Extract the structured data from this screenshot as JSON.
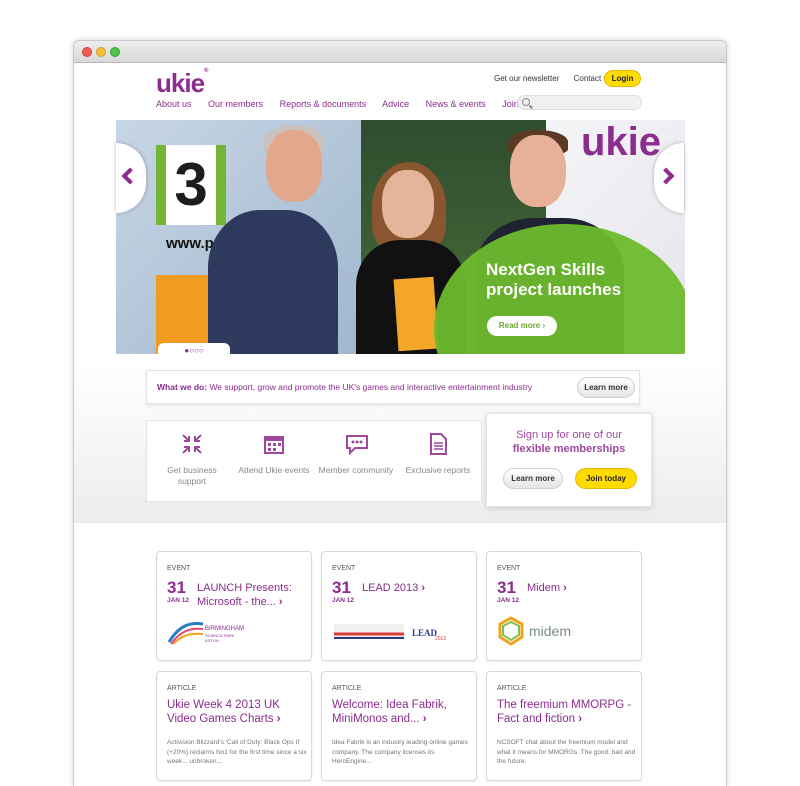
{
  "header": {
    "logo_text": "ukie",
    "newsletter_link": "Get our newsletter",
    "contact_link": "Contact us",
    "login_label": "Login"
  },
  "nav": {
    "items": [
      "About us",
      "Our members",
      "Reports & documents",
      "Advice",
      "News & events",
      "Join Ukie"
    ],
    "search_placeholder": ""
  },
  "hero": {
    "headline": "NextGen Skills project launches",
    "read_more_label": "Read more",
    "sign_number": "3",
    "sign_url": "www.pe",
    "slide_indicator": "●○○○",
    "accent_color": "#6ebb2d"
  },
  "what_we_do": {
    "label": "What we do:",
    "text": "We support, grow and promote the UK's games and interactive entertainment industry",
    "learn_more_label": "Learn more"
  },
  "features": [
    {
      "icon": "compress-arrows-icon",
      "label": "Get business support"
    },
    {
      "icon": "calendar-icon",
      "label": "Attend Ukie events"
    },
    {
      "icon": "chat-bubble-icon",
      "label": "Member community"
    },
    {
      "icon": "document-icon",
      "label": "Exclusive reports"
    }
  ],
  "signup": {
    "line1": "Sign up for one of our",
    "line2": "flexible memberships",
    "learn_more_label": "Learn more",
    "join_label": "Join today"
  },
  "events": [
    {
      "kind": "EVENT",
      "day": "31",
      "month": "JAN 12",
      "title": "LAUNCH Presents: Microsoft - the...",
      "logo_text": "BIRMINGHAM SCIENCE PARK ASTON"
    },
    {
      "kind": "EVENT",
      "day": "31",
      "month": "JAN 12",
      "title": "LEAD 2013",
      "logo_text": "LEAD 2013"
    },
    {
      "kind": "EVENT",
      "day": "31",
      "month": "JAN 12",
      "title": "Midem",
      "logo_text": "midem"
    }
  ],
  "articles": [
    {
      "kind": "ARTICLE",
      "title": "Ukie Week 4 2013 UK Video Games Charts",
      "excerpt": "Activision Blizzard's 'Call of Duty: Black Ops II' (+20%) reclaims No1 for the first time since a six week... unbroken..."
    },
    {
      "kind": "ARTICLE",
      "title": "Welcome: Idea Fabrik, MiniMonos and...",
      "excerpt": "Idea Fabrik is an industry leading online games company. The company licenses its HeroEngine..."
    },
    {
      "kind": "ARTICLE",
      "title": "The freemium MMORPG - Fact and fiction",
      "excerpt": "NCSOFT chat about the freemium model and what it means for MMORGs. The good, bad and the future."
    }
  ],
  "colors": {
    "brand_purple": "#8c2c8f",
    "button_yellow": "#ffdb00"
  }
}
